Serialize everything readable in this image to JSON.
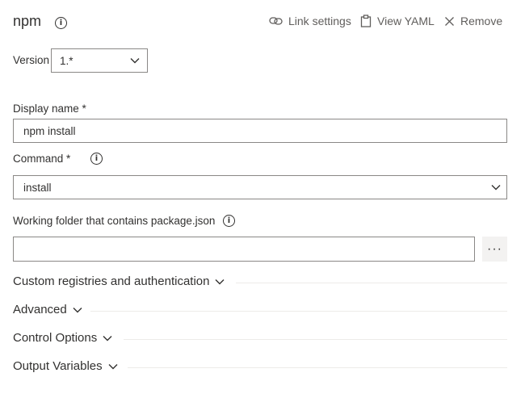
{
  "header": {
    "title": "npm",
    "actions": [
      {
        "label": "Link settings",
        "icon": "link-icon"
      },
      {
        "label": "View YAML",
        "icon": "clipboard-icon"
      },
      {
        "label": "Remove",
        "icon": "close-icon"
      }
    ]
  },
  "version": {
    "label": "Version",
    "value": "1.*"
  },
  "display_name": {
    "label": "Display name *",
    "value": "npm install"
  },
  "command": {
    "label": "Command *",
    "value": "install"
  },
  "working_folder": {
    "label": "Working folder that contains package.json",
    "value": "",
    "browse_label": "···"
  },
  "sections": [
    {
      "label": "Custom registries and authentication"
    },
    {
      "label": "Advanced"
    },
    {
      "label": "Control Options"
    },
    {
      "label": "Output Variables"
    }
  ]
}
